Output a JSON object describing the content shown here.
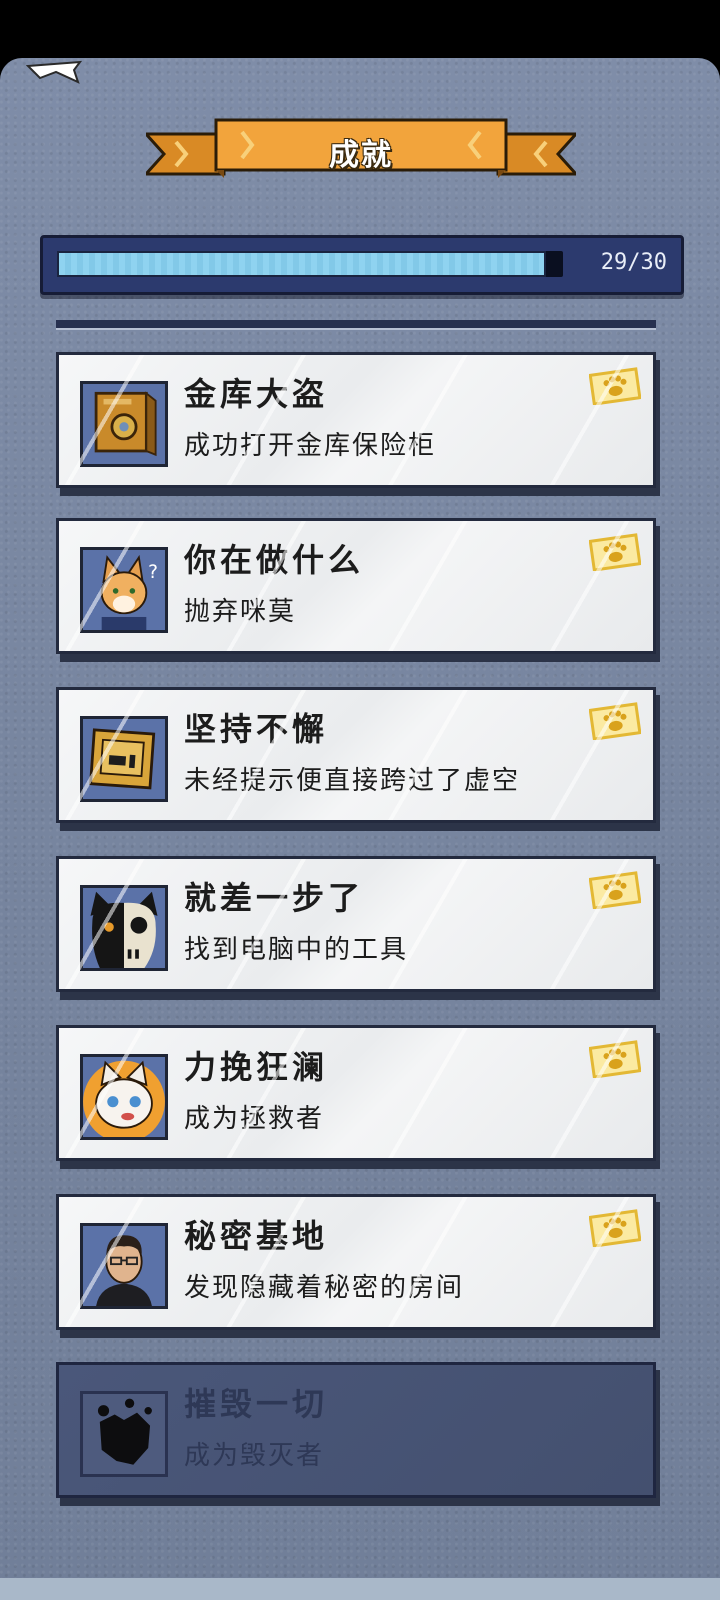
{
  "header": {
    "title": "成就"
  },
  "progress": {
    "text": "29/30",
    "completed": 29,
    "total": 30
  },
  "achievements": [
    {
      "title": "金库大盗",
      "description": "成功打开金库保险柜",
      "icon": "safe-icon",
      "unlocked": true
    },
    {
      "title": "你在做什么",
      "description": "抛弃咪莫",
      "icon": "cat-officer-icon",
      "unlocked": true
    },
    {
      "title": "坚持不懈",
      "description": "未经提示便直接跨过了虚空",
      "icon": "computer-screen-icon",
      "unlocked": true
    },
    {
      "title": "就差一步了",
      "description": "找到电脑中的工具",
      "icon": "cat-skull-icon",
      "unlocked": true
    },
    {
      "title": "力挽狂澜",
      "description": "成为拯救者",
      "icon": "white-cat-icon",
      "unlocked": true
    },
    {
      "title": "秘密基地",
      "description": "发现隐藏着秘密的房间",
      "icon": "man-portrait-icon",
      "unlocked": true
    },
    {
      "title": "摧毁一切",
      "description": "成为毁灭者",
      "icon": "rock-silhouette-icon",
      "unlocked": false
    }
  ],
  "colors": {
    "background": "#7a88a2",
    "banner": "#f0a13a",
    "progress_fill": "#8fd3f0",
    "card": "#f2f3f4",
    "badge": "#f2c94c"
  }
}
